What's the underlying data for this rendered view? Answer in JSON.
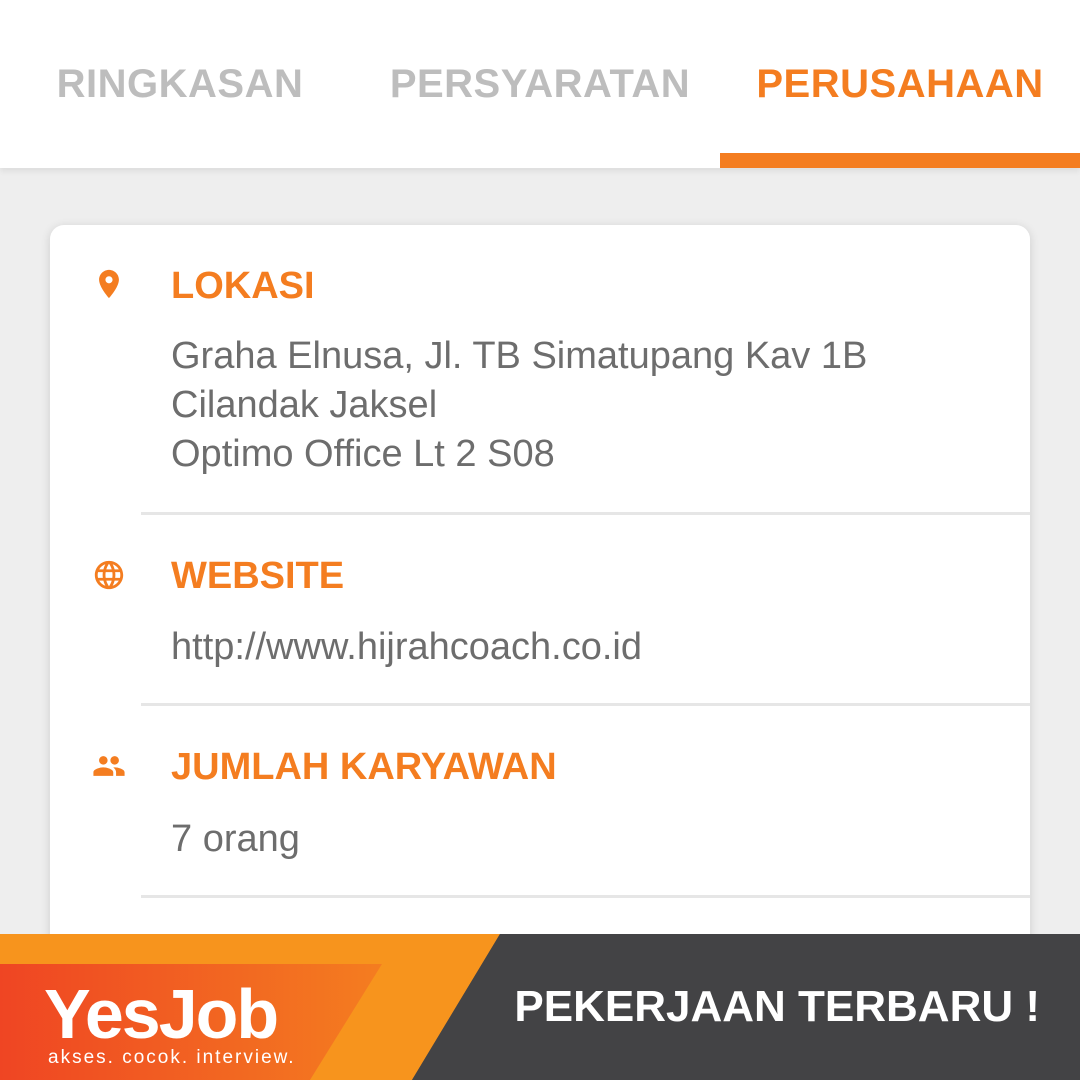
{
  "tabs": [
    {
      "label": "RINGKASAN",
      "active": false
    },
    {
      "label": "PERSYARATAN",
      "active": false
    },
    {
      "label": "PERUSAHAAN",
      "active": true
    }
  ],
  "company": {
    "location": {
      "icon": "location-pin-icon",
      "heading": "LOKASI",
      "lines": [
        "Graha Elnusa, Jl. TB Simatupang Kav 1B",
        "Cilandak Jaksel",
        "Optimo Office Lt 2 S08"
      ]
    },
    "website": {
      "icon": "globe-icon",
      "heading": "WEBSITE",
      "value": "http://www.hijrahcoach.co.id"
    },
    "employees": {
      "icon": "people-icon",
      "heading": "JUMLAH KARYAWAN",
      "value": "7 orang"
    }
  },
  "banner": {
    "logo": "YesJob",
    "tagline": "akses. cocok. interview.",
    "cta": "PEKERJAAN TERBARU !"
  },
  "colors": {
    "accent": "#f47d20",
    "inactive_tab": "#bdbdbd",
    "body_text": "#6d6d6d",
    "banner_dark": "#434345",
    "banner_red": "#ef4523"
  }
}
